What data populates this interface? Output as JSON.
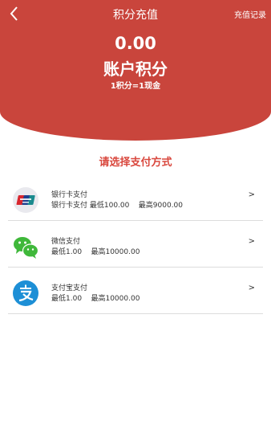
{
  "header": {
    "title": "积分充值",
    "records_label": "充值记录",
    "amount": "0.00",
    "account_label": "账户积分",
    "rate_text": "1积分=1现金",
    "background_color": "#c9453c"
  },
  "choose_label": "请选择支付方式",
  "payment_methods": [
    {
      "icon": "unionpay-icon",
      "name": "银行卡支付",
      "desc": "银行卡支付 最低100.00    最高9000.00",
      "arrow": ">"
    },
    {
      "icon": "wechat-icon",
      "name": "微信支付",
      "desc": "最低1.00    最高10000.00",
      "arrow": ">"
    },
    {
      "icon": "alipay-icon",
      "name": "支付宝支付",
      "desc": "最低1.00    最高10000.00",
      "arrow": ">"
    }
  ]
}
